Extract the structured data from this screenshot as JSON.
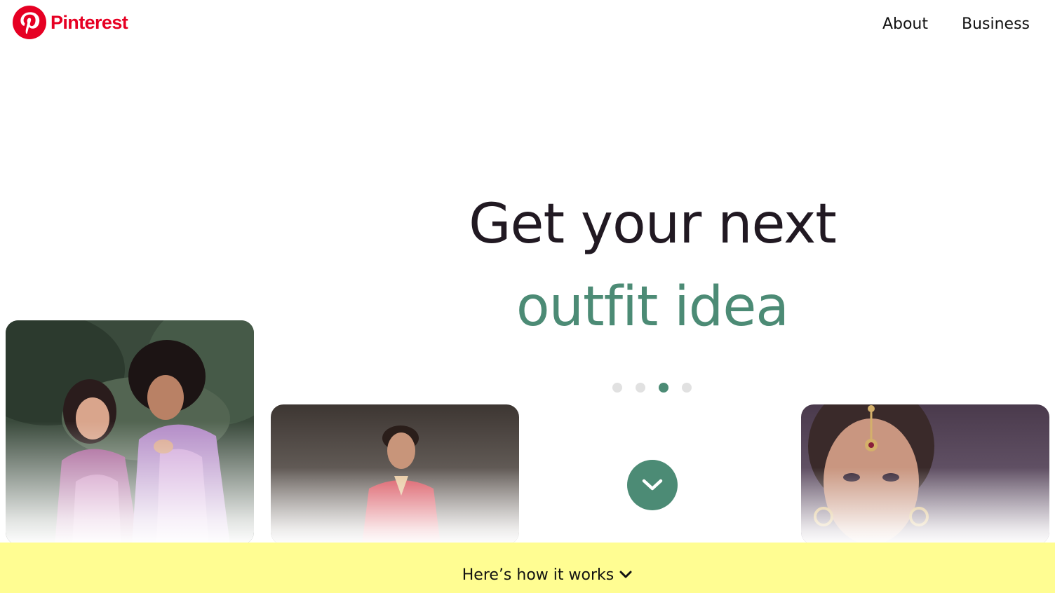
{
  "brand": {
    "name": "Pinterest",
    "color": "#e60023",
    "icon": "pinterest-logo-icon"
  },
  "nav": {
    "about": "About",
    "business": "Business"
  },
  "hero": {
    "line1": "Get your next",
    "line2": "outfit idea",
    "line1_color": "#211922",
    "line2_color": "#4c8b75",
    "carousel_dots": 4,
    "active_dot": 3
  },
  "cards": [
    {
      "subject": "couple in traditional outfits"
    },
    {
      "subject": "man in red sherwani"
    },
    {
      "subject": "woman with maang tikka jewelry"
    }
  ],
  "scroll_button": {
    "icon": "chevron-down-icon",
    "color": "#4c8b75"
  },
  "how_it_works": {
    "label": "Here’s how it works",
    "icon": "chevron-down-icon",
    "background": "#fffd92"
  }
}
